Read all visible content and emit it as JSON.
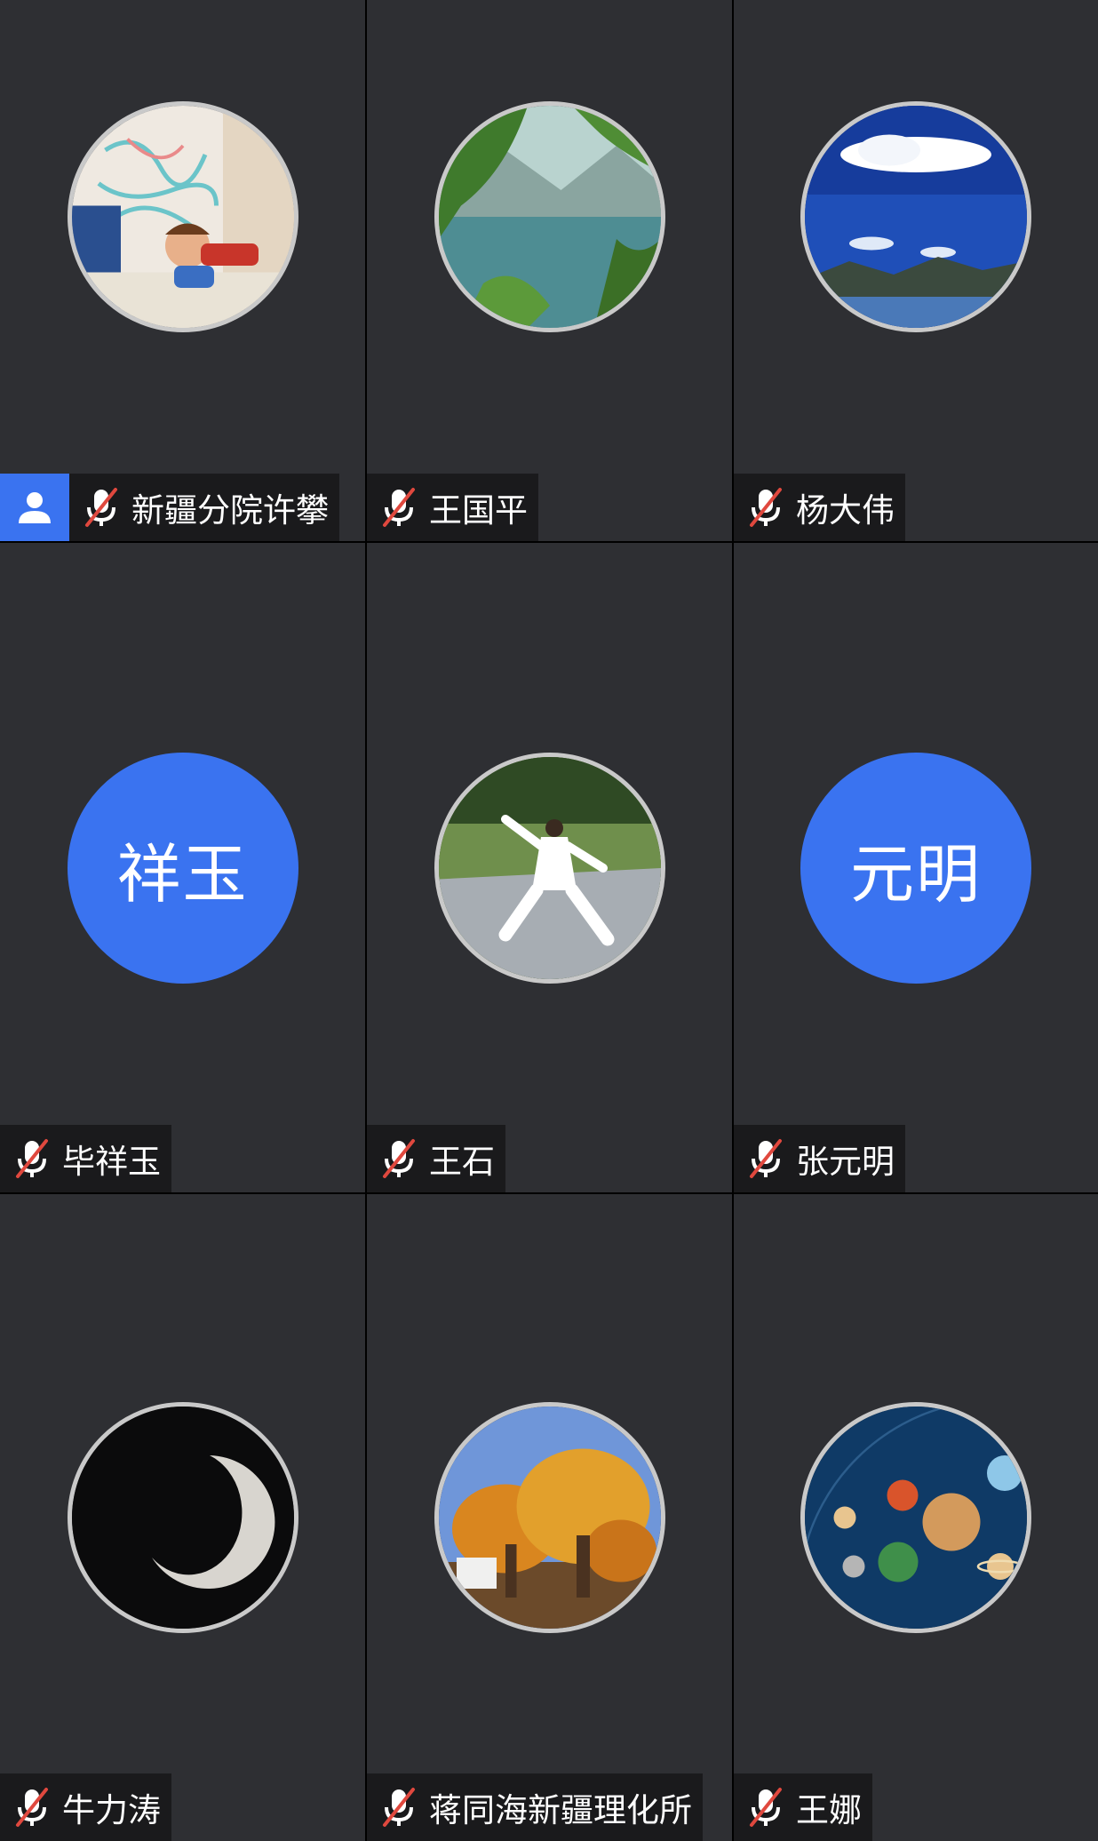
{
  "participants": [
    {
      "name": "新疆分院许攀",
      "host": true,
      "muted": true,
      "avatar": {
        "type": "photo",
        "icon": "child-drawing-avatar"
      }
    },
    {
      "name": "王国平",
      "host": false,
      "muted": true,
      "avatar": {
        "type": "photo",
        "icon": "mountain-lake-avatar"
      }
    },
    {
      "name": "杨大伟",
      "host": false,
      "muted": true,
      "avatar": {
        "type": "photo",
        "icon": "blue-sky-clouds-avatar"
      }
    },
    {
      "name": "毕祥玉",
      "host": false,
      "muted": true,
      "avatar": {
        "type": "initials",
        "text": "祥玉"
      }
    },
    {
      "name": "王石",
      "host": false,
      "muted": true,
      "avatar": {
        "type": "photo",
        "icon": "tai-chi-avatar"
      }
    },
    {
      "name": "张元明",
      "host": false,
      "muted": true,
      "avatar": {
        "type": "initials",
        "text": "元明"
      }
    },
    {
      "name": "牛力涛",
      "host": false,
      "muted": true,
      "avatar": {
        "type": "photo",
        "icon": "crescent-moon-avatar"
      }
    },
    {
      "name": "蒋同海新疆理化所",
      "host": false,
      "muted": true,
      "avatar": {
        "type": "photo",
        "icon": "autumn-trees-avatar"
      }
    },
    {
      "name": "王娜",
      "host": false,
      "muted": true,
      "avatar": {
        "type": "photo",
        "icon": "solar-system-avatar"
      }
    }
  ],
  "colors": {
    "tile_background": "#2e2f33",
    "accent_blue": "#3a73f0",
    "mute_slash_red": "#e0483e"
  }
}
